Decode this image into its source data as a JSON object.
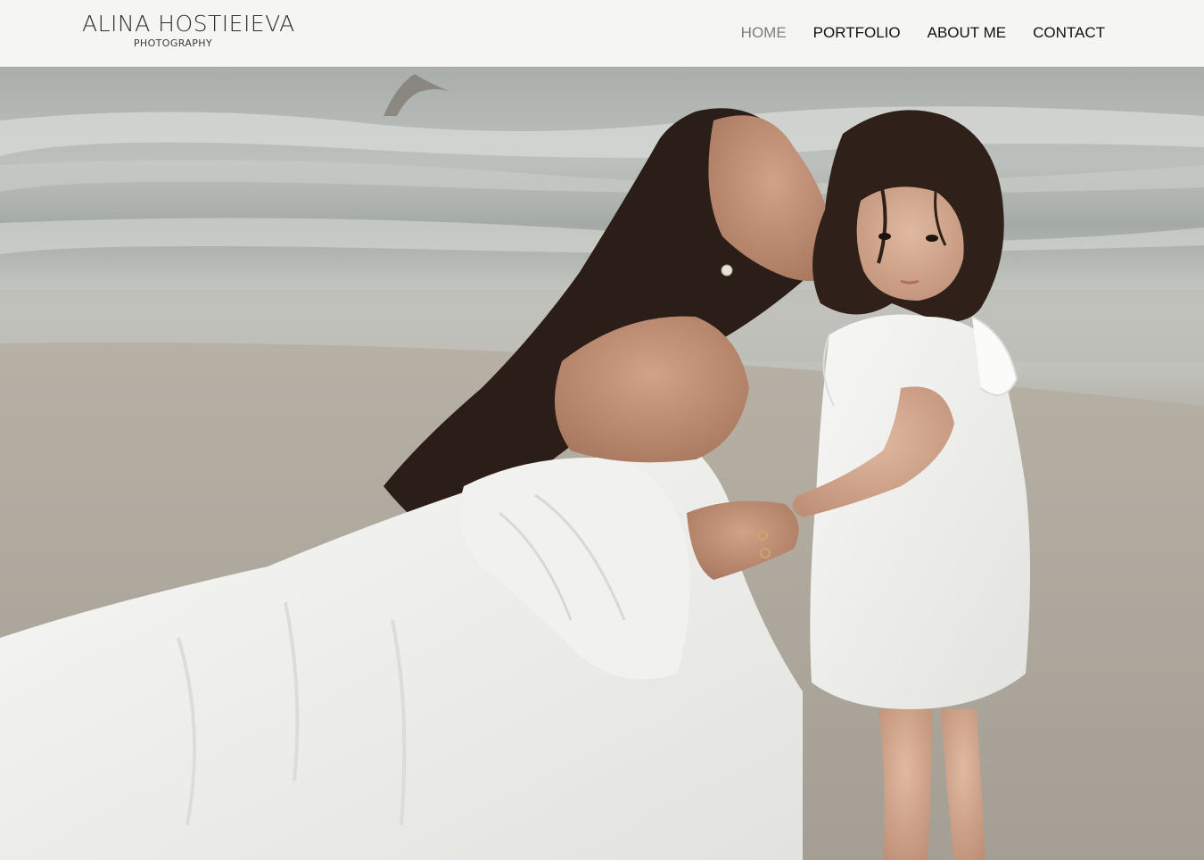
{
  "site": {
    "logo": {
      "name": "ALINA HOSTIEIEVA",
      "subtitle": "PHOTOGRAPHY"
    },
    "nav": {
      "items": [
        {
          "label": "HOME",
          "active": true
        },
        {
          "label": "PORTFOLIO",
          "active": false
        },
        {
          "label": "ABOUT ME",
          "active": false
        },
        {
          "label": "CONTACT",
          "active": false
        }
      ],
      "active_color": "#7d7d7d",
      "color": "#111111"
    }
  },
  "hero": {
    "image_subject": "mother-kissing-daughter-on-beach-photo",
    "colors": {
      "sea": "#a7aca8",
      "sand": "#b7b1a6",
      "dress": "#f4f4f2",
      "hair": "#2a1c16"
    }
  }
}
